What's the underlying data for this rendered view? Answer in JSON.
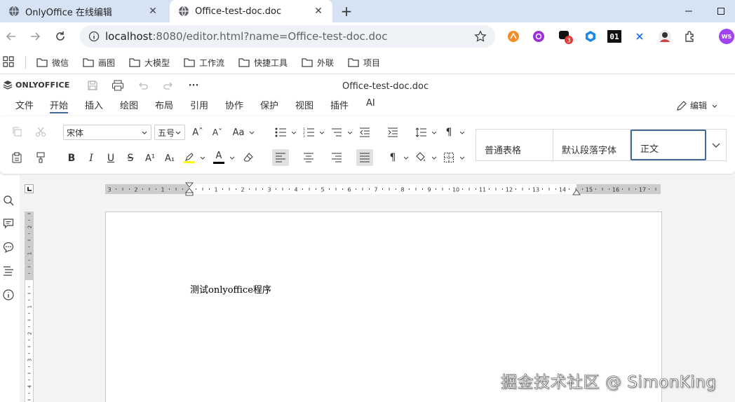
{
  "browser": {
    "tabs": [
      {
        "title": "OnlyOffice 在线编辑",
        "active": false
      },
      {
        "title": "Office-test-doc.doc",
        "active": true
      }
    ],
    "new_tab_label": "+",
    "url_host": "localhost",
    "url_rest": ":8080/editor.html?name=Office-test-doc.doc",
    "profile_initials": "WS",
    "extension_badge": "3",
    "extension_text": "01",
    "bookmarks": [
      "微信",
      "画图",
      "大模型",
      "工作流",
      "快捷工具",
      "外联",
      "项目"
    ]
  },
  "editor": {
    "brand": "ONLYOFFICE",
    "doc_title": "Office-test-doc.doc",
    "more_label": "···",
    "menu_tabs": [
      "文件",
      "开始",
      "插入",
      "绘图",
      "布局",
      "引用",
      "协作",
      "保护",
      "视图",
      "插件",
      "AI"
    ],
    "active_tab": "开始",
    "mode_label": "编辑",
    "font_name": "宋体",
    "font_size": "五号",
    "styles": [
      "普通表格",
      "默认段落字体",
      "正文"
    ],
    "selected_style": "正文",
    "glyphs": {
      "bold": "B",
      "italic": "I",
      "underline": "U",
      "strike": "S",
      "superscript": "A¹",
      "subscript": "A₁",
      "font_color": "A",
      "highlight": "A",
      "grow": "Aˆ",
      "shrink": "Aˇ",
      "case": "Aa",
      "pilcrow": "¶",
      "pilcrow_dir": "¶"
    }
  },
  "document": {
    "body_text": "测试onlyoffice程序"
  },
  "ruler": {
    "h_labels": [
      "3",
      "2",
      "1",
      "1",
      "2",
      "3",
      "4",
      "5",
      "6",
      "7",
      "8",
      "9",
      "10",
      "11",
      "12",
      "13",
      "14",
      "15",
      "16",
      "17"
    ],
    "v_labels": [
      "2",
      "1",
      "1",
      "2",
      "3",
      "4"
    ]
  },
  "watermark": "掘金技术社区 @ SimonKing",
  "colors": {
    "accent": "#446995",
    "highlight_yellow": "#ffff00",
    "font_color_bar": "#000000",
    "profile_purple": "#a142f4"
  }
}
